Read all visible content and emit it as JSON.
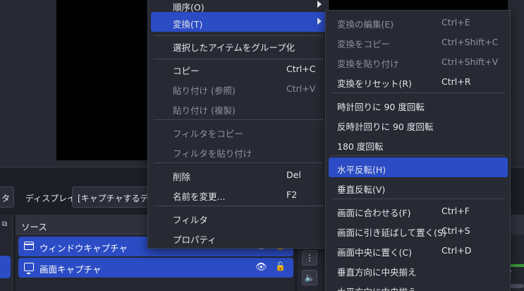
{
  "toolbar": {
    "left_button": "タ",
    "display_label": "ディスプレイ",
    "capture_select": "[キャプチャするディスプレイ"
  },
  "sources": {
    "title": "ソース",
    "items": [
      {
        "label": "ウィンドウキャプチャ",
        "icon": "window-icon"
      },
      {
        "label": "画面キャプチャ",
        "icon": "monitor-icon"
      }
    ]
  },
  "mixer": {
    "menu_dots": "⋮",
    "volume_icon": "🔈",
    "meter_value": "0"
  },
  "context_menu": {
    "items": {
      "order": "順序(O)",
      "transform": "変換(T)",
      "group_selected": "選択したアイテムをグループ化",
      "copy": "コピー",
      "copy_shortcut": "Ctrl+C",
      "paste_ref": "貼り付け (参照)",
      "paste_ref_shortcut": "Ctrl+V",
      "paste_dup": "貼り付け (複製)",
      "copy_filters": "フィルタをコピー",
      "paste_filters": "フィルタを貼り付け",
      "delete": "削除",
      "delete_shortcut": "Del",
      "rename": "名前を変更...",
      "rename_shortcut": "F2",
      "filters": "フィルタ",
      "properties": "プロパティ"
    }
  },
  "transform_menu": {
    "items": {
      "edit": "変換の編集(E)",
      "edit_shortcut": "Ctrl+E",
      "copy": "変換をコピー",
      "copy_shortcut": "Ctrl+Shift+C",
      "paste": "変換を貼り付け",
      "paste_shortcut": "Ctrl+Shift+V",
      "reset": "変換をリセット(R)",
      "reset_shortcut": "Ctrl+R",
      "rot_cw": "時計回りに 90 度回転",
      "rot_ccw": "反時計回りに 90 度回転",
      "rot_180": "180 度回転",
      "flip_h": "水平反転(H)",
      "flip_v": "垂直反転(V)",
      "fit_screen": "画面に合わせる(F)",
      "fit_screen_shortcut": "Ctrl+F",
      "stretch": "画面に引き延ばして置く(S)",
      "stretch_shortcut": "Ctrl+S",
      "center": "画面中央に置く(C)",
      "center_shortcut": "Ctrl+D",
      "center_v": "垂直方向に中央揃え",
      "center_h": "水平方向に中央揃え"
    }
  },
  "colors": {
    "accent": "#2b4cc4",
    "menu_bg": "#272a33",
    "text": "#e4e6ee",
    "disabled_text": "#8e92a0"
  }
}
